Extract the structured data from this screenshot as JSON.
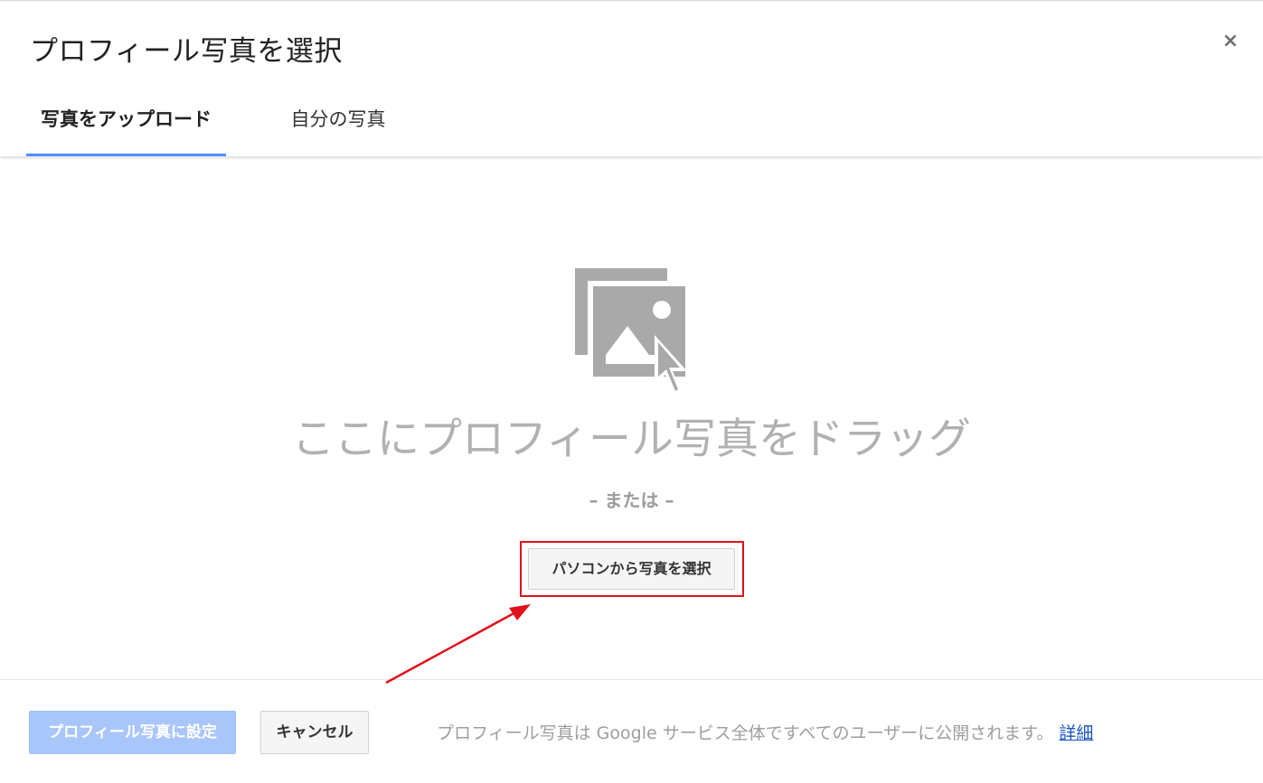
{
  "dialog": {
    "title": "プロフィール写真を選択",
    "close_label": "×"
  },
  "tabs": [
    {
      "label": "写真をアップロード",
      "active": true
    },
    {
      "label": "自分の写真",
      "active": false
    }
  ],
  "upload": {
    "drag_text": "ここにプロフィール写真をドラッグ",
    "or_text": "– または –",
    "select_button_label": "パソコンから写真を選択",
    "icon": "image-upload-icon"
  },
  "footer": {
    "set_button_label": "プロフィール写真に設定",
    "set_button_enabled": false,
    "cancel_button_label": "キャンセル",
    "note": "プロフィール写真は Google サービス全体ですべてのユーザーに公開されます。",
    "link_label": "詳細"
  },
  "annotation": {
    "highlight_color": "#e0101c",
    "arrow_color": "#e0101c"
  },
  "colors": {
    "accent": "#4d90fe",
    "primary_disabled": "#a9c6fa",
    "link": "#1a54c4"
  }
}
